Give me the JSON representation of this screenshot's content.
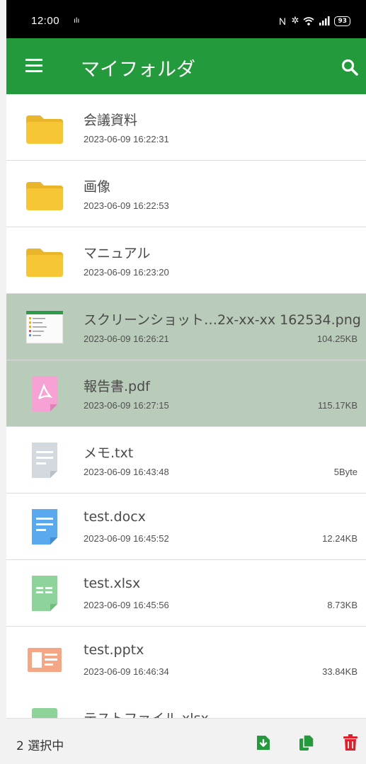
{
  "status_bar": {
    "time": "12:00",
    "battery": "93"
  },
  "app_bar": {
    "title": "マイフォルダ"
  },
  "files": [
    {
      "name": "会議資料",
      "date": "2023-06-09 16:22:31",
      "size": "",
      "type": "folder",
      "selected": false
    },
    {
      "name": "画像",
      "date": "2023-06-09 16:22:53",
      "size": "",
      "type": "folder",
      "selected": false
    },
    {
      "name": "マニュアル",
      "date": "2023-06-09 16:23:20",
      "size": "",
      "type": "folder",
      "selected": false
    },
    {
      "name": "スクリーンショット…2x-xx-xx 162534.png",
      "date": "2023-06-09 16:26:21",
      "size": "104.25KB",
      "type": "image",
      "selected": true
    },
    {
      "name": "報告書.pdf",
      "date": "2023-06-09 16:27:15",
      "size": "115.17KB",
      "type": "pdf",
      "selected": true
    },
    {
      "name": "メモ.txt",
      "date": "2023-06-09 16:43:48",
      "size": "5Byte",
      "type": "txt",
      "selected": false
    },
    {
      "name": "test.docx",
      "date": "2023-06-09 16:45:52",
      "size": "12.24KB",
      "type": "docx",
      "selected": false
    },
    {
      "name": "test.xlsx",
      "date": "2023-06-09 16:45:56",
      "size": "8.73KB",
      "type": "xlsx",
      "selected": false
    },
    {
      "name": "test.pptx",
      "date": "2023-06-09 16:46:34",
      "size": "33.84KB",
      "type": "pptx",
      "selected": false
    }
  ],
  "partial_file": {
    "name": "テストファイル.xlsx",
    "type": "xlsx"
  },
  "bottom_bar": {
    "selection_count": "2 選択中"
  },
  "colors": {
    "primary": "#239a3b",
    "selected_row": "#b9cbb9",
    "folder": "#f7c637",
    "delete": "#e0202a"
  }
}
